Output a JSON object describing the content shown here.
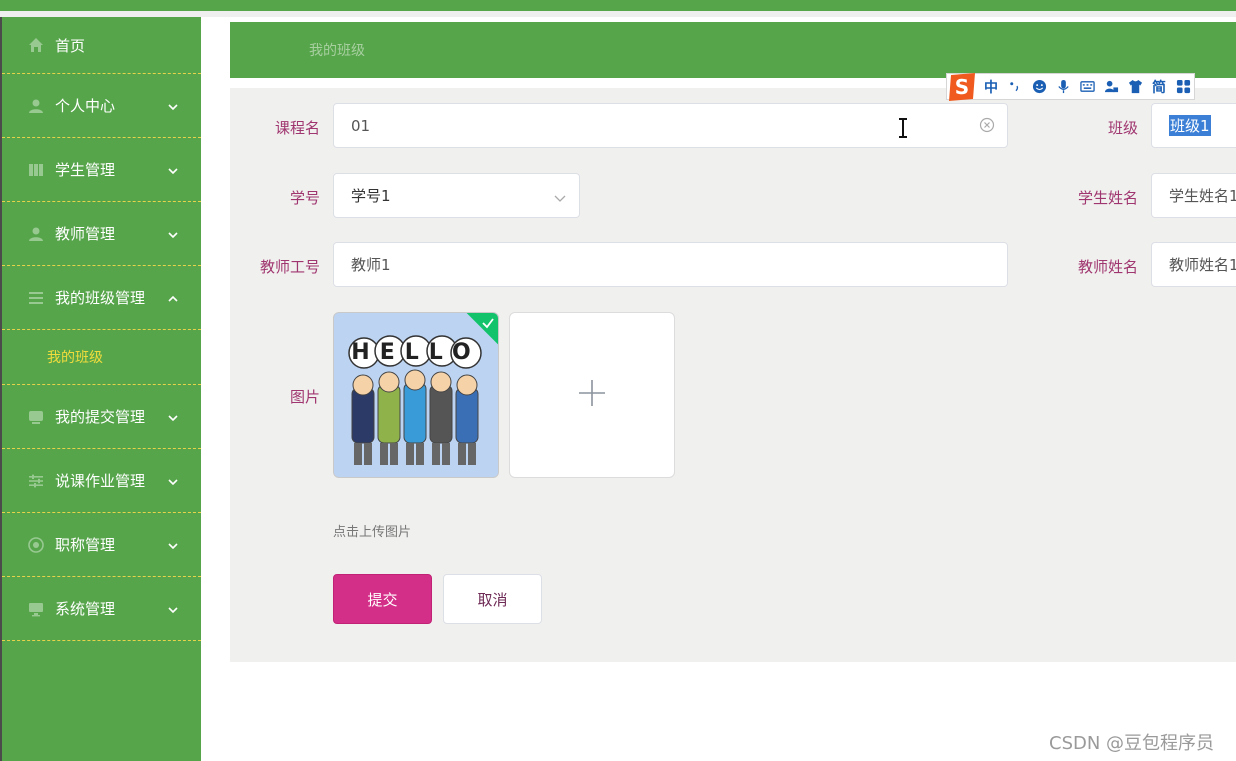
{
  "sidebar": {
    "items": [
      {
        "label": "首页",
        "icon": "home-icon",
        "expandable": false
      },
      {
        "label": "个人中心",
        "icon": "user-icon",
        "expandable": true
      },
      {
        "label": "学生管理",
        "icon": "grid-icon",
        "expandable": true
      },
      {
        "label": "教师管理",
        "icon": "person-icon",
        "expandable": true
      },
      {
        "label": "我的班级管理",
        "icon": "list-icon",
        "expandable": true,
        "expanded": true
      },
      {
        "label": "我的提交管理",
        "icon": "inbox-icon",
        "expandable": true
      },
      {
        "label": "说课作业管理",
        "icon": "sliders-icon",
        "expandable": true
      },
      {
        "label": "职称管理",
        "icon": "badge-icon",
        "expandable": true
      },
      {
        "label": "系统管理",
        "icon": "monitor-icon",
        "expandable": true
      }
    ],
    "sub_item": {
      "label": "我的班级"
    }
  },
  "breadcrumb": {
    "current": "我的班级"
  },
  "form": {
    "course_name": {
      "label": "课程名",
      "value": "01"
    },
    "class": {
      "label": "班级",
      "value": "班级1"
    },
    "student_no": {
      "label": "学号",
      "value": "学号1"
    },
    "student_name": {
      "label": "学生姓名",
      "value": "学生姓名1"
    },
    "teacher_no": {
      "label": "教师工号",
      "value": "教师1"
    },
    "teacher_name": {
      "label": "教师姓名",
      "value": "教师姓名1"
    },
    "picture": {
      "label": "图片",
      "hint": "点击上传图片",
      "image_text": "HELLO"
    },
    "submit_label": "提交",
    "cancel_label": "取消"
  },
  "ime": {
    "mode_label": "中",
    "simplified_label": "简"
  },
  "watermark": "CSDN @豆包程序员",
  "colors": {
    "sidebar": "#56a54b",
    "label": "#a0366f",
    "submit": "#d42f88",
    "submenu": "#f0dc3c"
  }
}
